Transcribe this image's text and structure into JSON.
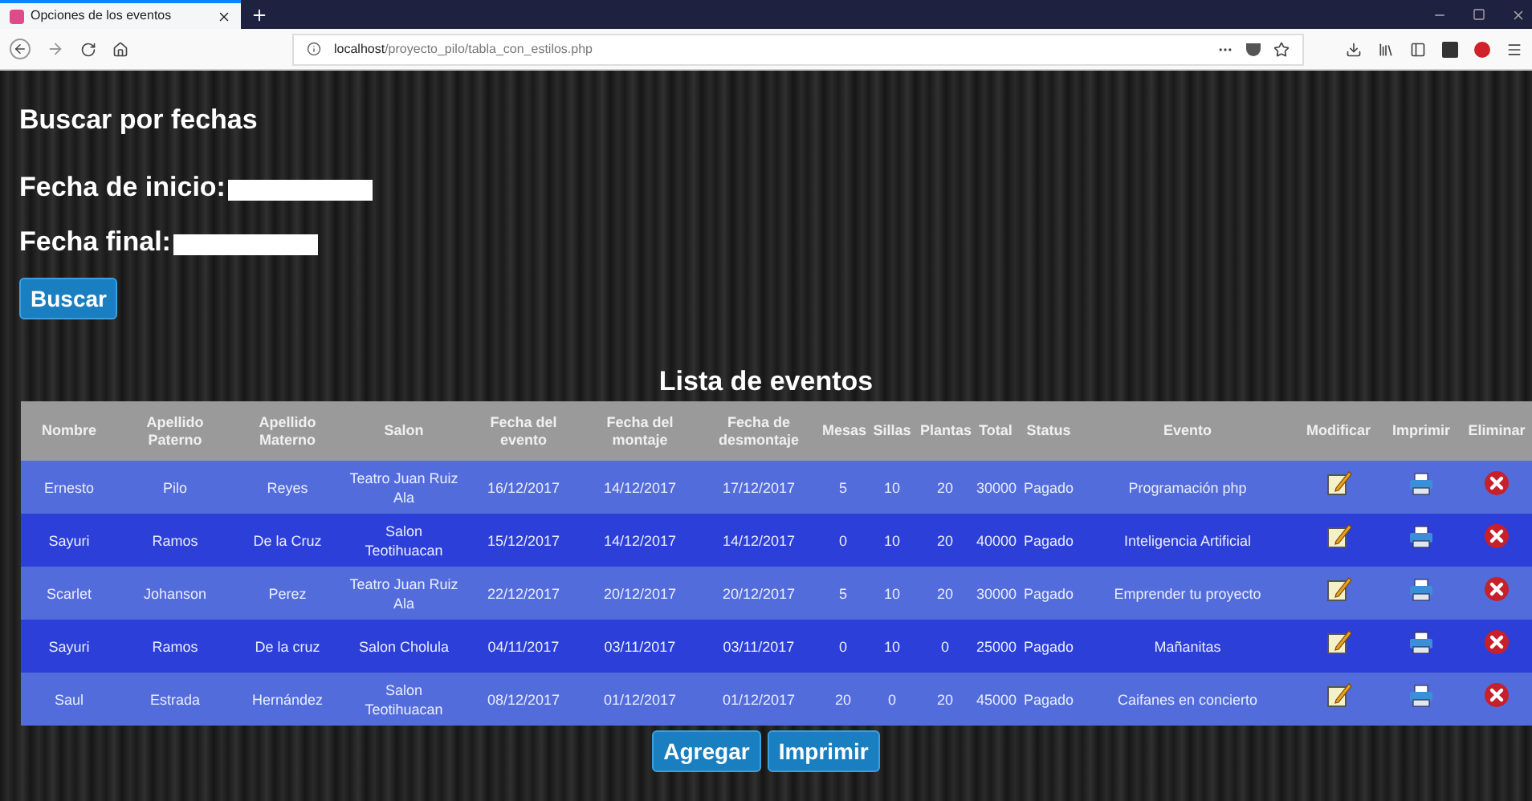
{
  "browser": {
    "tab_title": "Opciones de los eventos",
    "url_host": "localhost",
    "url_path": "/proyecto_pilo/tabla_con_estilos.php"
  },
  "search": {
    "title": "Buscar por fechas",
    "fields": [
      {
        "label": "Fecha de inicio:"
      },
      {
        "label": "Fecha final:"
      }
    ],
    "button": "Buscar"
  },
  "table": {
    "title": "Lista de eventos",
    "columns": [
      "Nombre",
      "Apellido Paterno",
      "Apellido Materno",
      "Salon",
      "Fecha del evento",
      "Fecha del montaje",
      "Fecha de desmontaje",
      "Mesas",
      "Sillas",
      "Plantas",
      "Total",
      "Status",
      "Evento",
      "Modificar",
      "Imprimir",
      "Eliminar"
    ],
    "rows": [
      [
        "Ernesto",
        "Pilo",
        "Reyes",
        "Teatro Juan Ruiz Ala",
        "16/12/2017",
        "14/12/2017",
        "17/12/2017",
        "5",
        "10",
        "20",
        "30000",
        "Pagado",
        "Programación php"
      ],
      [
        "Sayuri",
        "Ramos",
        "De la Cruz",
        "Salon Teotihuacan",
        "15/12/2017",
        "14/12/2017",
        "14/12/2017",
        "0",
        "10",
        "20",
        "40000",
        "Pagado",
        "Inteligencia Artificial"
      ],
      [
        "Scarlet",
        "Johanson",
        "Perez",
        "Teatro Juan Ruiz Ala",
        "22/12/2017",
        "20/12/2017",
        "20/12/2017",
        "5",
        "10",
        "20",
        "30000",
        "Pagado",
        "Emprender tu proyecto"
      ],
      [
        "Sayuri",
        "Ramos",
        "De la cruz",
        "Salon Cholula",
        "04/11/2017",
        "03/11/2017",
        "03/11/2017",
        "0",
        "10",
        "0",
        "25000",
        "Pagado",
        "Mañanitas"
      ],
      [
        "Saul",
        "Estrada",
        "Hernández",
        "Salon Teotihuacan",
        "08/12/2017",
        "01/12/2017",
        "01/12/2017",
        "20",
        "0",
        "20",
        "45000",
        "Pagado",
        "Caifanes en concierto"
      ]
    ]
  },
  "buttons": [
    "Agregar",
    "Imprimir"
  ]
}
